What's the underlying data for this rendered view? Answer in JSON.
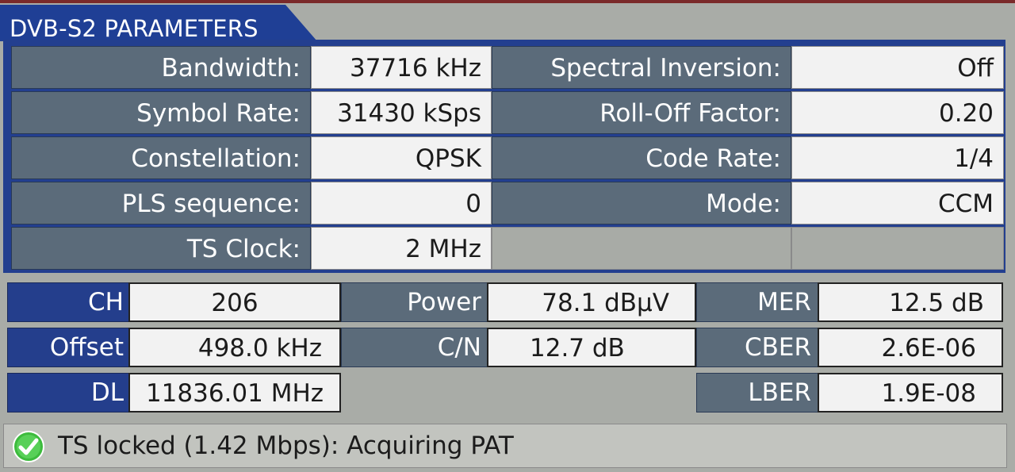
{
  "title": "DVB-S2 PARAMETERS",
  "parameters": [
    {
      "label": "Bandwidth:",
      "value": "37716 kHz",
      "label2": "Spectral Inversion:",
      "value2": "Off"
    },
    {
      "label": "Symbol Rate:",
      "value": "31430 kSps",
      "label2": "Roll-Off Factor:",
      "value2": "0.20"
    },
    {
      "label": "Constellation:",
      "value": "QPSK",
      "label2": "Code Rate:",
      "value2": "1/4"
    },
    {
      "label": "PLS sequence:",
      "value": "0",
      "label2": "Mode:",
      "value2": "CCM"
    },
    {
      "label": "TS Clock:",
      "value": "2 MHz",
      "label2": "",
      "value2": ""
    }
  ],
  "measurements": {
    "ch": {
      "label": "CH",
      "value": "206"
    },
    "offset": {
      "label": "Offset",
      "value": "498.0  kHz"
    },
    "dl": {
      "label": "DL",
      "value": "11836.01  MHz"
    },
    "power": {
      "label": "Power",
      "value": "78.1  dBµV"
    },
    "cn": {
      "label": "C/N",
      "value": "12.7  dB"
    },
    "mer": {
      "label": "MER",
      "value": "12.5  dB"
    },
    "cber": {
      "label": "CBER",
      "value": "2.6E-06"
    },
    "lber": {
      "label": "LBER",
      "value": "1.9E-08"
    }
  },
  "status": {
    "icon": "check-circle-icon",
    "text": "TS locked (1.42 Mbps): Acquiring PAT"
  },
  "colors": {
    "title_bar": "#1f3f95",
    "label_bg": "#5b6b7a",
    "value_bg": "#f2f2f2",
    "blue_label": "#243e8c",
    "ok_green": "#3dbb3d"
  }
}
